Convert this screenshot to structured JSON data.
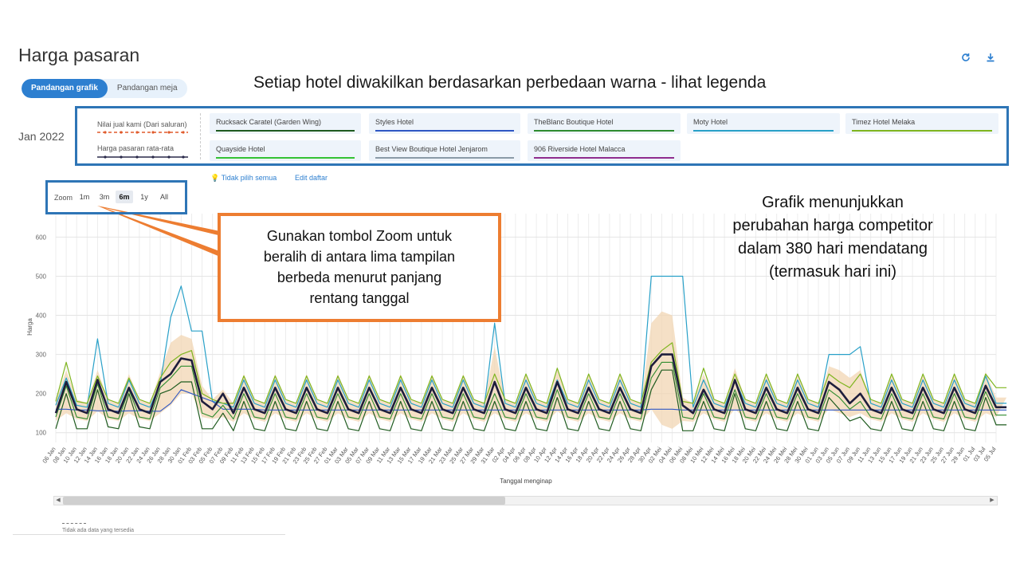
{
  "page_title": "Harga pasaran",
  "icons": {
    "refresh": "refresh-icon",
    "download": "download-icon"
  },
  "view_toggle": {
    "graph": "Pandangan grafik",
    "table": "Pandangan meja"
  },
  "annotations": {
    "top_caption": "Setiap hotel diwakilkan berdasarkan perbedaan warna - lihat legenda",
    "zoom_callout": [
      "Gunakan tombol Zoom untuk",
      "beralih di antara lima tampilan",
      "berbeda menurut panjang",
      "rentang tanggal"
    ],
    "right_note": [
      "Grafik menunjukkan",
      "perubahan harga competitor",
      "dalam 380 hari mendatang",
      "(termasuk hari ini)"
    ]
  },
  "month_label": "Jan 2022",
  "legend": {
    "our_price": "Nilai jual kami (Dari saluran)",
    "market_avg": "Harga pasaran rata-rata",
    "hotels": [
      {
        "name": "Rucksack Caratel (Garden Wing)",
        "color": "#1f5b1f"
      },
      {
        "name": "Styles Hotel",
        "color": "#2f57c4"
      },
      {
        "name": "TheBlanc Boutique Hotel",
        "color": "#2e8b2e"
      },
      {
        "name": "Moty Hotel",
        "color": "#28a0c8"
      },
      {
        "name": "Timez Hotel Melaka",
        "color": "#7fb51f"
      },
      {
        "name": "Quayside Hotel",
        "color": "#34c234"
      },
      {
        "name": "Best View Boutique Hotel Jenjarom",
        "color": "#8a9aa8"
      },
      {
        "name": "906 Riverside Hotel Malacca",
        "color": "#8e2c8e"
      }
    ]
  },
  "actions": {
    "deselect_all": "Tidak pilih semua",
    "edit_list": "Edit daftar"
  },
  "zoom": {
    "label": "Zoom",
    "options": [
      "1m",
      "3m",
      "6m",
      "1y",
      "All"
    ],
    "selected": "6m"
  },
  "colors": {
    "accent": "#2d7fd0",
    "frame": "#2e75b6",
    "callout": "#ed7d31",
    "our_price": "#e05a2b",
    "market_avg": "#2a2a4a",
    "band": "#f1d6b3"
  },
  "footer": {
    "no_data": "Tidak ada data yang tersedia"
  },
  "chart_data": {
    "type": "line",
    "ylabel": "Harga",
    "xlabel": "Tanggal menginap",
    "ylim": [
      100,
      600
    ],
    "yticks": [
      100,
      200,
      300,
      400,
      500,
      600
    ],
    "grid": true,
    "x": [
      "06 Jan",
      "08 Jan",
      "10 Jan",
      "12 Jan",
      "14 Jan",
      "16 Jan",
      "18 Jan",
      "20 Jan",
      "22 Jan",
      "24 Jan",
      "26 Jan",
      "28 Jan",
      "30 Jan",
      "01 Feb",
      "03 Feb",
      "05 Feb",
      "07 Feb",
      "09 Feb",
      "11 Feb",
      "13 Feb",
      "15 Feb",
      "17 Feb",
      "19 Feb",
      "21 Feb",
      "23 Feb",
      "25 Feb",
      "27 Feb",
      "01 Mar",
      "03 Mar",
      "05 Mar",
      "07 Mar",
      "09 Mar",
      "11 Mar",
      "13 Mar",
      "15 Mar",
      "17 Mar",
      "19 Mar",
      "21 Mar",
      "23 Mar",
      "25 Mar",
      "27 Mar",
      "29 Mar",
      "31 Mar",
      "02 Apr",
      "04 Apr",
      "06 Apr",
      "08 Apr",
      "10 Apr",
      "12 Apr",
      "14 Apr",
      "16 Apr",
      "18 Apr",
      "20 Apr",
      "22 Apr",
      "24 Apr",
      "26 Apr",
      "28 Apr",
      "30 Apr",
      "02 Mei",
      "04 Mei",
      "06 Mei",
      "08 Mei",
      "10 Mei",
      "12 Mei",
      "14 Mei",
      "16 Mei",
      "18 Mei",
      "20 Mei",
      "22 Mei",
      "24 Mei",
      "26 Mei",
      "28 Mei",
      "30 Mei",
      "01 Jun",
      "03 Jun",
      "05 Jun",
      "07 Jun",
      "09 Jun",
      "11 Jun",
      "13 Jun",
      "15 Jun",
      "17 Jun",
      "19 Jun",
      "21 Jun",
      "23 Jun",
      "25 Jun",
      "27 Jun",
      "29 Jun",
      "01 Jul",
      "03 Jul",
      "05 Jul"
    ],
    "series": [
      {
        "name": "Harga pasaran rata-rata",
        "color": "#1e1e3c",
        "width": 2.6,
        "values": [
          150,
          230,
          160,
          150,
          235,
          160,
          150,
          215,
          160,
          150,
          230,
          250,
          290,
          285,
          180,
          160,
          200,
          150,
          215,
          160,
          150,
          215,
          160,
          150,
          215,
          160,
          150,
          215,
          160,
          150,
          215,
          160,
          150,
          215,
          160,
          150,
          215,
          160,
          150,
          215,
          160,
          150,
          230,
          160,
          150,
          215,
          160,
          150,
          230,
          160,
          150,
          215,
          160,
          150,
          215,
          160,
          150,
          270,
          300,
          300,
          170,
          150,
          210,
          160,
          150,
          235,
          160,
          150,
          215,
          160,
          150,
          215,
          160,
          150,
          230,
          210,
          175,
          200,
          160,
          150,
          215,
          160,
          150,
          215,
          160,
          150,
          215,
          160,
          150,
          220,
          165,
          165
        ]
      },
      {
        "name": "Moty Hotel",
        "color": "#28a0c8",
        "width": 1.2,
        "values": [
          170,
          240,
          170,
          165,
          340,
          175,
          165,
          235,
          175,
          165,
          225,
          395,
          475,
          360,
          360,
          180,
          175,
          165,
          235,
          175,
          165,
          235,
          175,
          165,
          235,
          175,
          165,
          235,
          175,
          165,
          235,
          175,
          165,
          235,
          175,
          165,
          235,
          175,
          165,
          235,
          175,
          165,
          380,
          175,
          165,
          235,
          175,
          165,
          235,
          175,
          165,
          235,
          175,
          165,
          235,
          175,
          165,
          500,
          500,
          500,
          500,
          165,
          235,
          175,
          165,
          235,
          175,
          165,
          235,
          175,
          165,
          235,
          175,
          165,
          300,
          300,
          300,
          320,
          175,
          165,
          235,
          175,
          165,
          235,
          175,
          165,
          235,
          175,
          165,
          245,
          175,
          175
        ]
      },
      {
        "name": "Timez Hotel Melaka",
        "color": "#7fb51f",
        "width": 1.2,
        "values": [
          180,
          280,
          180,
          175,
          245,
          185,
          175,
          240,
          185,
          175,
          240,
          280,
          300,
          310,
          200,
          185,
          175,
          175,
          245,
          185,
          175,
          245,
          185,
          175,
          245,
          185,
          175,
          245,
          185,
          175,
          245,
          185,
          175,
          245,
          185,
          175,
          245,
          185,
          175,
          245,
          185,
          175,
          250,
          185,
          175,
          250,
          185,
          175,
          265,
          185,
          175,
          250,
          185,
          175,
          250,
          185,
          175,
          280,
          310,
          330,
          180,
          175,
          265,
          185,
          175,
          250,
          185,
          175,
          250,
          185,
          175,
          250,
          185,
          175,
          250,
          230,
          215,
          250,
          185,
          175,
          250,
          185,
          175,
          250,
          185,
          175,
          250,
          185,
          175,
          250,
          215,
          215
        ]
      },
      {
        "name": "Rucksack Caratel (Garden Wing)",
        "color": "#1f5b1f",
        "width": 1.2,
        "values": [
          110,
          200,
          110,
          110,
          210,
          115,
          110,
          200,
          115,
          110,
          200,
          210,
          230,
          230,
          110,
          110,
          150,
          105,
          180,
          110,
          105,
          180,
          110,
          105,
          180,
          110,
          105,
          180,
          110,
          105,
          180,
          110,
          105,
          180,
          110,
          105,
          180,
          110,
          105,
          180,
          110,
          105,
          180,
          110,
          105,
          180,
          110,
          105,
          190,
          110,
          105,
          180,
          110,
          105,
          180,
          110,
          105,
          210,
          260,
          260,
          105,
          105,
          180,
          110,
          105,
          200,
          110,
          105,
          180,
          110,
          105,
          180,
          110,
          105,
          190,
          160,
          130,
          140,
          110,
          105,
          180,
          110,
          105,
          180,
          110,
          105,
          180,
          110,
          105,
          190,
          120,
          120
        ]
      },
      {
        "name": "Styles Hotel",
        "color": "#2f57c4",
        "width": 1.1,
        "values": [
          160,
          160,
          158,
          158,
          156,
          156,
          155,
          156,
          156,
          155,
          155,
          175,
          210,
          200,
          190,
          180,
          160,
          160,
          160,
          160,
          158,
          158,
          158,
          158,
          158,
          158,
          158,
          158,
          158,
          158,
          158,
          158,
          158,
          158,
          158,
          158,
          158,
          158,
          158,
          158,
          158,
          158,
          158,
          158,
          158,
          158,
          158,
          158,
          158,
          158,
          158,
          158,
          158,
          158,
          158,
          158,
          158,
          160,
          160,
          160,
          158,
          158,
          158,
          158,
          158,
          158,
          158,
          158,
          158,
          158,
          158,
          158,
          158,
          158,
          158,
          158,
          158,
          158,
          158,
          158,
          158,
          158,
          158,
          158,
          158,
          158,
          158,
          158,
          158,
          158,
          158,
          158
        ]
      },
      {
        "name": "TheBlanc Boutique Hotel",
        "color": "#2e8b2e",
        "width": 1.1,
        "values": [
          140,
          220,
          140,
          135,
          225,
          140,
          135,
          210,
          140,
          135,
          215,
          240,
          270,
          270,
          150,
          140,
          170,
          135,
          200,
          140,
          135,
          200,
          140,
          135,
          200,
          140,
          135,
          200,
          140,
          135,
          200,
          140,
          135,
          200,
          140,
          135,
          200,
          140,
          135,
          200,
          140,
          135,
          200,
          140,
          135,
          200,
          140,
          135,
          210,
          140,
          135,
          200,
          140,
          135,
          200,
          140,
          135,
          240,
          280,
          280,
          140,
          135,
          200,
          140,
          135,
          210,
          140,
          135,
          200,
          140,
          135,
          200,
          140,
          135,
          210,
          190,
          160,
          180,
          140,
          135,
          200,
          140,
          135,
          200,
          140,
          135,
          200,
          140,
          135,
          205,
          145,
          145
        ]
      }
    ],
    "band": {
      "low": [
        130,
        150,
        135,
        130,
        155,
        135,
        130,
        150,
        135,
        130,
        150,
        170,
        200,
        200,
        140,
        135,
        140,
        128,
        150,
        135,
        128,
        150,
        135,
        128,
        150,
        135,
        128,
        150,
        135,
        128,
        150,
        135,
        128,
        150,
        135,
        128,
        150,
        135,
        128,
        150,
        135,
        128,
        150,
        135,
        128,
        150,
        135,
        128,
        155,
        135,
        128,
        150,
        135,
        128,
        150,
        135,
        128,
        160,
        120,
        110,
        130,
        128,
        150,
        135,
        128,
        160,
        135,
        128,
        150,
        135,
        128,
        150,
        135,
        128,
        160,
        150,
        140,
        150,
        135,
        128,
        150,
        135,
        128,
        150,
        135,
        128,
        150,
        135,
        128,
        150,
        140,
        140
      ],
      "high": [
        180,
        260,
        185,
        175,
        260,
        185,
        175,
        250,
        185,
        175,
        255,
        330,
        350,
        340,
        220,
        185,
        210,
        175,
        250,
        185,
        175,
        250,
        185,
        175,
        250,
        185,
        175,
        250,
        185,
        175,
        250,
        185,
        175,
        250,
        185,
        175,
        250,
        185,
        175,
        250,
        185,
        175,
        320,
        185,
        175,
        250,
        185,
        175,
        260,
        185,
        175,
        250,
        185,
        175,
        250,
        185,
        175,
        380,
        410,
        400,
        190,
        175,
        250,
        185,
        175,
        265,
        185,
        175,
        250,
        185,
        175,
        250,
        185,
        175,
        270,
        260,
        240,
        260,
        185,
        175,
        250,
        185,
        175,
        250,
        185,
        175,
        250,
        185,
        175,
        255,
        190,
        190
      ]
    }
  }
}
